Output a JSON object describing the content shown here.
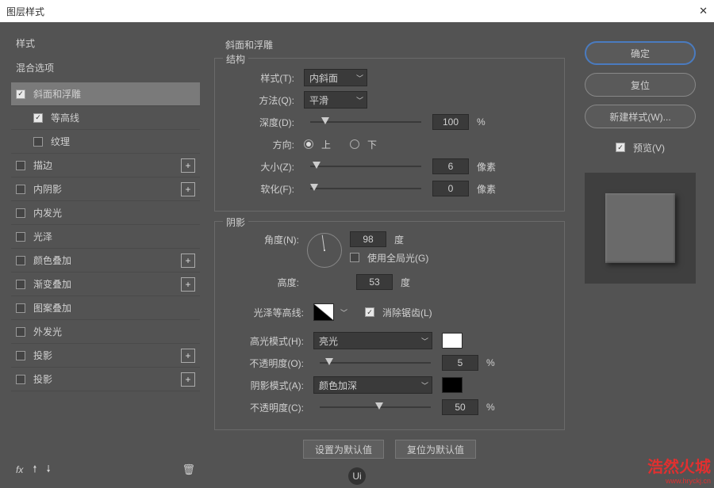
{
  "title": "图层样式",
  "left": {
    "styles_label": "样式",
    "blend_options_label": "混合选项",
    "effects": [
      {
        "label": "斜面和浮雕",
        "checked": true,
        "selected": true,
        "plus": false,
        "indent": false
      },
      {
        "label": "等高线",
        "checked": true,
        "selected": false,
        "plus": false,
        "indent": true
      },
      {
        "label": "纹理",
        "checked": false,
        "selected": false,
        "plus": false,
        "indent": true
      },
      {
        "label": "描边",
        "checked": false,
        "selected": false,
        "plus": true,
        "indent": false
      },
      {
        "label": "内阴影",
        "checked": false,
        "selected": false,
        "plus": true,
        "indent": false
      },
      {
        "label": "内发光",
        "checked": false,
        "selected": false,
        "plus": false,
        "indent": false
      },
      {
        "label": "光泽",
        "checked": false,
        "selected": false,
        "plus": false,
        "indent": false
      },
      {
        "label": "颜色叠加",
        "checked": false,
        "selected": false,
        "plus": true,
        "indent": false
      },
      {
        "label": "渐变叠加",
        "checked": false,
        "selected": false,
        "plus": true,
        "indent": false
      },
      {
        "label": "图案叠加",
        "checked": false,
        "selected": false,
        "plus": false,
        "indent": false
      },
      {
        "label": "外发光",
        "checked": false,
        "selected": false,
        "plus": false,
        "indent": false
      },
      {
        "label": "投影",
        "checked": false,
        "selected": false,
        "plus": true,
        "indent": false
      },
      {
        "label": "投影",
        "checked": false,
        "selected": false,
        "plus": true,
        "indent": false
      }
    ],
    "fx": "fx"
  },
  "center": {
    "title": "斜面和浮雕",
    "structure": {
      "legend": "结构",
      "style_label": "样式(T):",
      "style_value": "内斜面",
      "technique_label": "方法(Q):",
      "technique_value": "平滑",
      "depth_label": "深度(D):",
      "depth_value": "100",
      "depth_unit": "%",
      "direction_label": "方向:",
      "up_label": "上",
      "down_label": "下",
      "size_label": "大小(Z):",
      "size_value": "6",
      "size_unit": "像素",
      "soften_label": "软化(F):",
      "soften_value": "0",
      "soften_unit": "像素"
    },
    "shading": {
      "legend": "阴影",
      "angle_label": "角度(N):",
      "angle_value": "98",
      "angle_unit": "度",
      "global_light_label": "使用全局光(G)",
      "altitude_label": "高度:",
      "altitude_value": "53",
      "altitude_unit": "度",
      "gloss_contour_label": "光泽等高线:",
      "antialias_label": "消除锯齿(L)",
      "highlight_mode_label": "高光模式(H):",
      "highlight_mode_value": "亮光",
      "highlight_opacity_label": "不透明度(O):",
      "highlight_opacity_value": "5",
      "highlight_opacity_unit": "%",
      "shadow_mode_label": "阴影模式(A):",
      "shadow_mode_value": "颜色加深",
      "shadow_opacity_label": "不透明度(C):",
      "shadow_opacity_value": "50",
      "shadow_opacity_unit": "%",
      "highlight_color": "#ffffff",
      "shadow_color": "#000000"
    },
    "default_btn": "设置为默认值",
    "reset_btn": "复位为默认值"
  },
  "right": {
    "ok": "确定",
    "cancel": "复位",
    "new_style": "新建样式(W)...",
    "preview_label": "预览(V)"
  },
  "watermark": {
    "name": "浩然火城",
    "url": "www.hryckj.cn"
  },
  "badge": "Ui"
}
